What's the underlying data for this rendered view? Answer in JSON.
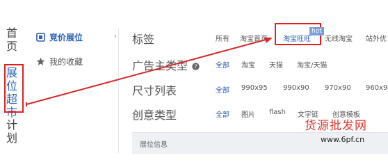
{
  "nav": {
    "home": [
      "首",
      "页"
    ],
    "active": [
      "展",
      "位",
      "超",
      "市"
    ],
    "plan": [
      "计",
      "划"
    ]
  },
  "sidebar": {
    "items": [
      {
        "label": "竞价展位",
        "icon": "ticket-icon"
      },
      {
        "label": "我的收藏",
        "icon": "star-icon"
      }
    ]
  },
  "collapse_glyph": "‹",
  "filters": {
    "rows": [
      {
        "label": "标签",
        "options": [
          "所有",
          "淘宝首页",
          "淘宝旺旺",
          "无线淘宝",
          "站外优"
        ]
      },
      {
        "label": "广告主类型",
        "options": [
          "全部",
          "淘宝",
          "天猫",
          "淘宝/天猫"
        ]
      },
      {
        "label": "尺寸列表",
        "options": [
          "全部",
          "990x95",
          "990x90",
          "970x90",
          "960x9"
        ]
      },
      {
        "label": "创意类型",
        "options": [
          "全部",
          "图片",
          "flash",
          "文字链",
          "创意模板"
        ]
      }
    ],
    "hot_badge": "hot"
  },
  "table": {
    "header": "展位信息"
  },
  "watermark": {
    "text": "货源批发网",
    "url": "www.6pf.cn"
  },
  "colors": {
    "accent": "#2b5fb3",
    "highlight": "#e02020"
  }
}
